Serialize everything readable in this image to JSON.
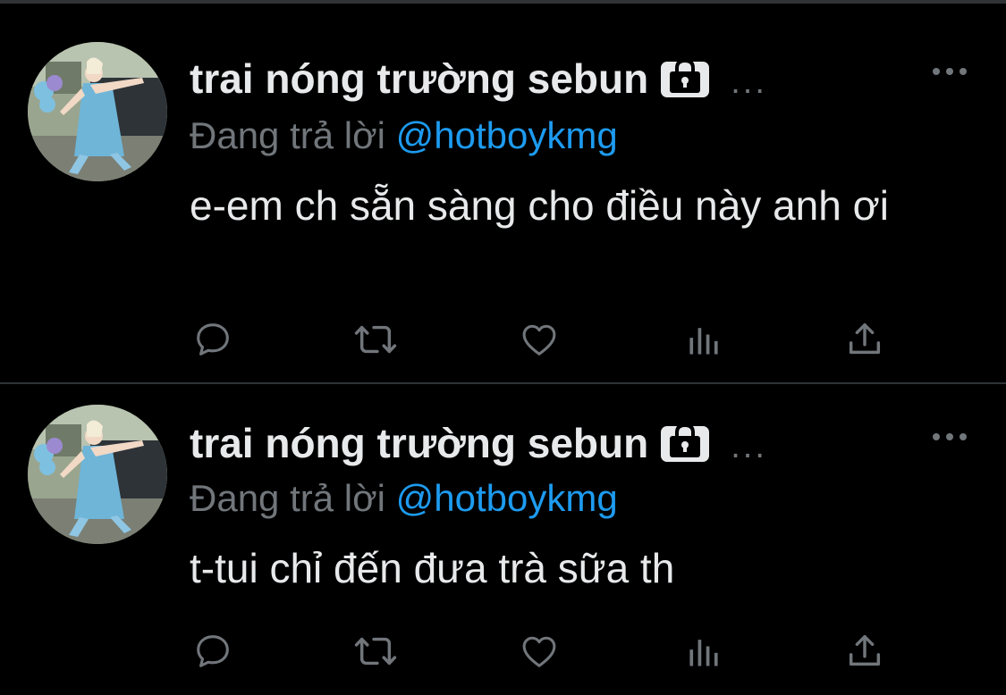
{
  "colors": {
    "background": "#000000",
    "divider": "#2f3336",
    "primary_text": "#e7e9ea",
    "secondary_text": "#71767b",
    "link": "#1d9bf0"
  },
  "tweets": [
    {
      "display_name": "trai nóng trường sebun",
      "name_ellipsis": "...",
      "protected_icon": "lock-icon",
      "reply_prefix": "Đang trả lời",
      "reply_handle": "@hotboykmg",
      "text": "e-em ch sẵn sàng cho điều này anh ơi",
      "actions": [
        "reply-icon",
        "retweet-icon",
        "like-icon",
        "analytics-icon",
        "share-icon"
      ]
    },
    {
      "display_name": "trai nóng trường sebun",
      "name_ellipsis": "...",
      "protected_icon": "lock-icon",
      "reply_prefix": "Đang trả lời",
      "reply_handle": "@hotboykmg",
      "text": "t-tui chỉ đến đưa trà sữa th",
      "actions": [
        "reply-icon",
        "retweet-icon",
        "like-icon",
        "analytics-icon",
        "share-icon"
      ]
    }
  ]
}
